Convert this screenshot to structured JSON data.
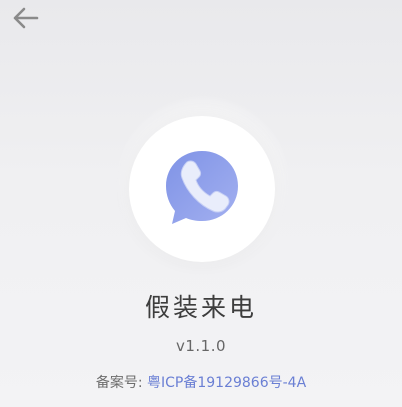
{
  "header": {
    "back_icon": "arrow-left-icon"
  },
  "logo": {
    "icon": "phone-chat-bubble-icon",
    "bubble_color": "#8b9be8",
    "phone_color": "#e8ecfb"
  },
  "app": {
    "name": "假装来电",
    "version": "v1.1.0"
  },
  "footer": {
    "icp_label": "备案号:",
    "icp_number": "粤ICP备19129866号-4A"
  },
  "colors": {
    "link": "#6a7fd4",
    "title": "#3d3d3d"
  }
}
